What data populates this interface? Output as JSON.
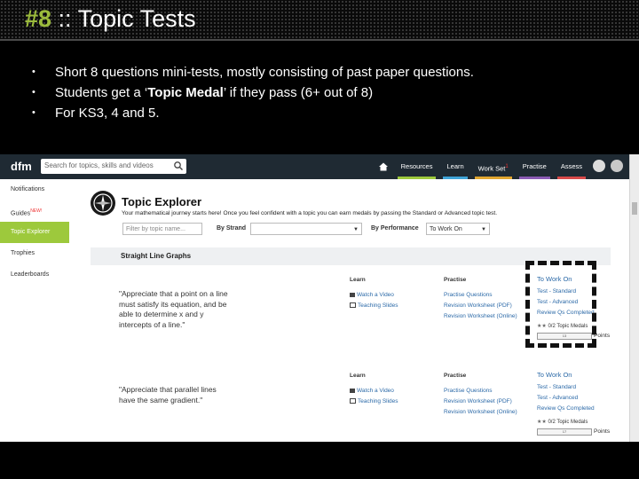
{
  "slide": {
    "number": "#8",
    "title_sep": " :: ",
    "title": "Topic Tests",
    "bullets": [
      {
        "pre": "Short 8 questions mini-tests, mostly consisting of past paper questions.",
        "bold": "",
        "post": ""
      },
      {
        "pre": "Students get a ‘",
        "bold": "Topic Medal",
        "post": "’ if they pass (6+ out of 8)"
      },
      {
        "pre": "For KS3, 4 and 5.",
        "bold": "",
        "post": ""
      }
    ],
    "bullet_glyph": "•"
  },
  "app": {
    "logo": "dfm",
    "search_placeholder": "Search for topics, skills and videos",
    "nav": [
      {
        "label": "Resources",
        "color": "#9dc93c"
      },
      {
        "label": "Learn",
        "color": "#3fa4d8"
      },
      {
        "label": "Work Set",
        "badge": "1",
        "color": "#e0a630"
      },
      {
        "label": "Practise",
        "color": "#8a5ab4"
      },
      {
        "label": "Assess",
        "color": "#d84a4a"
      }
    ],
    "sidebar": [
      {
        "label": "Notifications",
        "active": false
      },
      {
        "label": "Guides",
        "badge": "NEW!",
        "active": false
      },
      {
        "label": "Topic Explorer",
        "active": true
      },
      {
        "label": "Trophies",
        "active": false
      },
      {
        "label": "Leaderboards",
        "active": false
      }
    ],
    "explorer": {
      "title": "Topic Explorer",
      "subtitle": "Your mathematical journey starts here! Once you feel confident with a topic you can earn medals by passing the Standard or Advanced topic test.",
      "filter_placeholder": "Filter by topic name...",
      "by_strand_label": "By Strand",
      "by_performance_label": "By Performance",
      "performance_value": "To Work On"
    },
    "section_title": "Straight Line Graphs",
    "rows": [
      {
        "quote": "\"Appreciate that a point on a line must satisfy its equation, and be able to determine x and y intercepts of a line.\"",
        "learn_header": "Learn",
        "learn": [
          "Watch a Video",
          "Teaching Slides"
        ],
        "practise_header": "Practise",
        "practise": [
          "Practise Questions",
          "Revision Worksheet (PDF)",
          "Revision Worksheet (Online)"
        ],
        "status": "To Work On",
        "tests": [
          "Test - Standard",
          "Test - Advanced",
          "Review Qs Completed"
        ],
        "medals": "0/2 Topic Medals",
        "points_value": "13",
        "points_label": "Points"
      },
      {
        "quote": "\"Appreciate that parallel lines have the same gradient.\"",
        "learn_header": "Learn",
        "learn": [
          "Watch a Video",
          "Teaching Slides"
        ],
        "practise_header": "Practise",
        "practise": [
          "Practise Questions",
          "Revision Worksheet (PDF)",
          "Revision Worksheet (Online)"
        ],
        "status": "To Work On",
        "tests": [
          "Test - Standard",
          "Test - Advanced",
          "Review Qs Completed"
        ],
        "medals": "0/2 Topic Medals",
        "points_value": "17",
        "points_label": "Points"
      }
    ]
  }
}
